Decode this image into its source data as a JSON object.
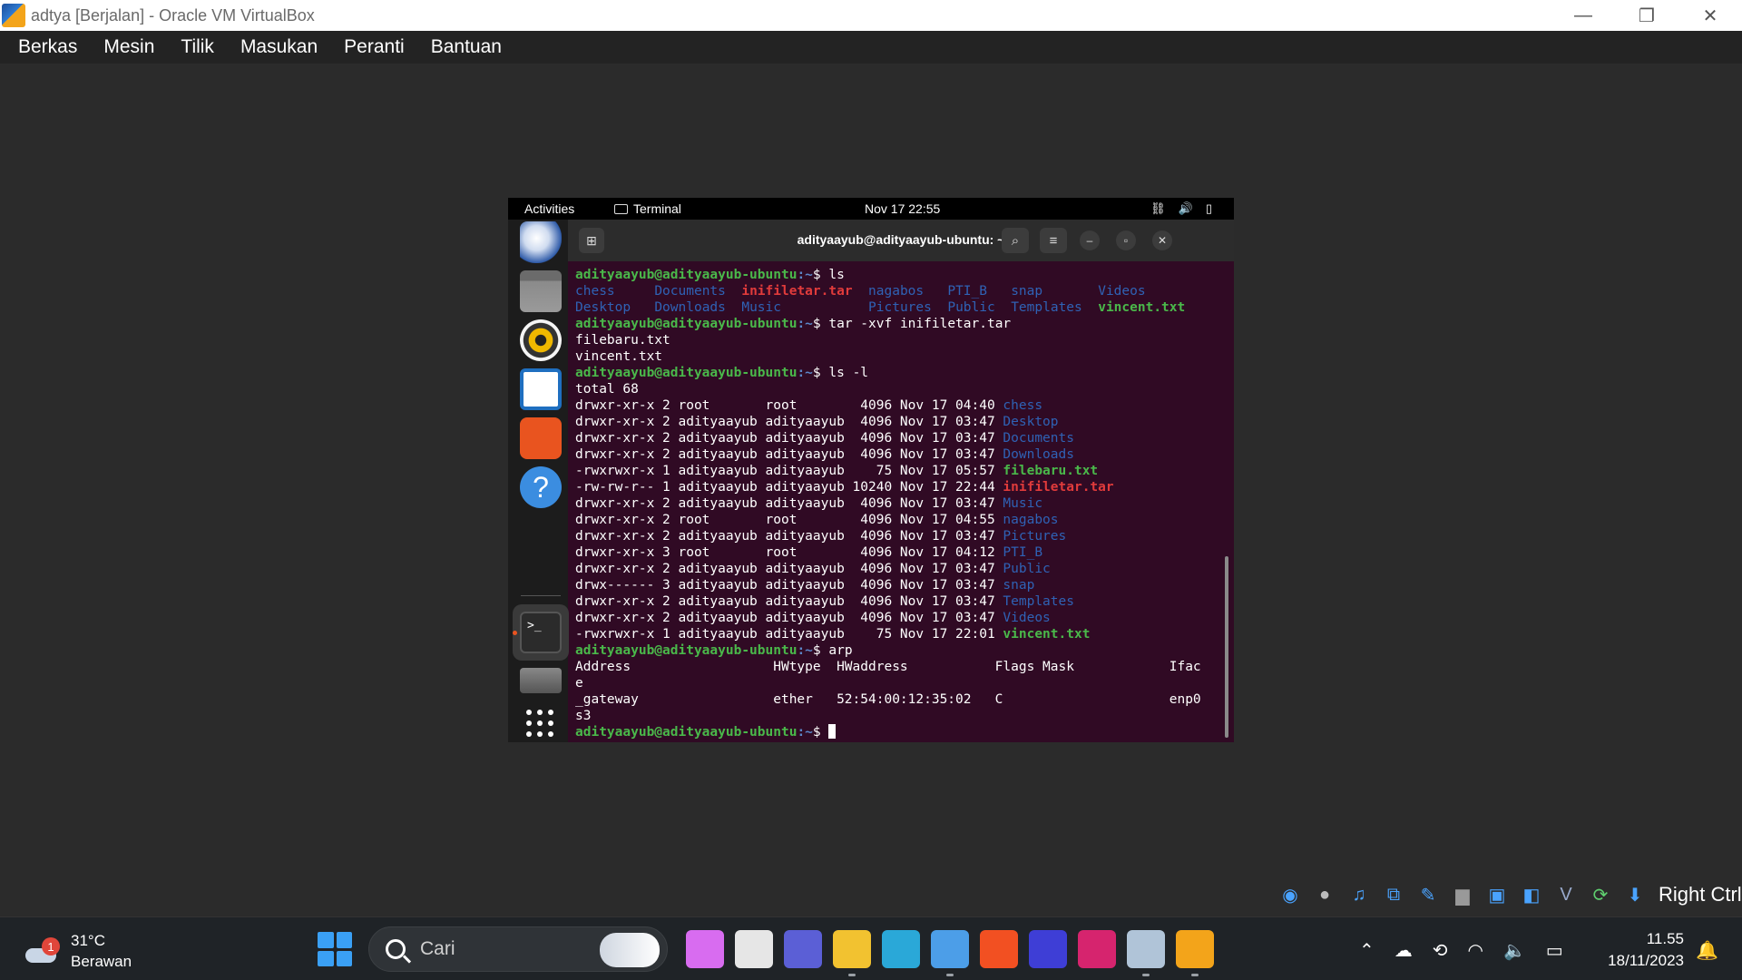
{
  "host_window": {
    "title": "adtya [Berjalan] - Oracle VM VirtualBox",
    "controls": {
      "minimize": "—",
      "maximize": "❐",
      "close": "✕"
    }
  },
  "host_menu": [
    "Berkas",
    "Mesin",
    "Tilik",
    "Masukan",
    "Peranti",
    "Bantuan"
  ],
  "gnome": {
    "activities": "Activities",
    "app_name": "Terminal",
    "clock": "Nov 17  22:55",
    "status_icons": [
      "network-icon",
      "volume-icon",
      "battery-icon"
    ]
  },
  "dock_items": [
    "thunderbird-icon",
    "files-icon",
    "rhythmbox-icon",
    "writer-icon",
    "app-center-icon",
    "help-icon",
    "terminal-icon",
    "removable-drive-icon",
    "show-apps-icon"
  ],
  "terminal": {
    "title": "adityaayub@adityaayub-ubuntu: ~",
    "prompt_user": "adityaayub@adityaayub-ubuntu",
    "prompt_path": ":~",
    "prompt_symbol": "$ ",
    "commands": [
      "ls",
      "tar -xvf inifiletar.tar",
      "ls -l",
      "arp"
    ],
    "ls_row1": [
      {
        "text": "chess     ",
        "cls": "c-dir"
      },
      {
        "text": "Documents  ",
        "cls": "c-dir"
      },
      {
        "text": "inifiletar.tar",
        "cls": "c-red"
      },
      {
        "text": "  ",
        "cls": ""
      },
      {
        "text": "nagabos   ",
        "cls": "c-dir"
      },
      {
        "text": "PTI_B   ",
        "cls": "c-dir"
      },
      {
        "text": "snap       ",
        "cls": "c-dir"
      },
      {
        "text": "Videos",
        "cls": "c-dir"
      }
    ],
    "ls_row2": [
      {
        "text": "Desktop   ",
        "cls": "c-dir"
      },
      {
        "text": "Downloads  ",
        "cls": "c-dir"
      },
      {
        "text": "Music         ",
        "cls": "c-dir"
      },
      {
        "text": "  ",
        "cls": ""
      },
      {
        "text": "Pictures  ",
        "cls": "c-dir"
      },
      {
        "text": "Public  ",
        "cls": "c-dir"
      },
      {
        "text": "Templates  ",
        "cls": "c-dir"
      },
      {
        "text": "vincent.txt",
        "cls": "c-exec"
      }
    ],
    "tar_output": [
      "filebaru.txt",
      "vincent.txt"
    ],
    "total": "total 68",
    "ls_long": [
      {
        "meta": "drwxr-xr-x 2 root       root        4096 Nov 17 04:40 ",
        "name": "chess",
        "cls": "c-dir"
      },
      {
        "meta": "drwxr-xr-x 2 adityaayub adityaayub  4096 Nov 17 03:47 ",
        "name": "Desktop",
        "cls": "c-dir"
      },
      {
        "meta": "drwxr-xr-x 2 adityaayub adityaayub  4096 Nov 17 03:47 ",
        "name": "Documents",
        "cls": "c-dir"
      },
      {
        "meta": "drwxr-xr-x 2 adityaayub adityaayub  4096 Nov 17 03:47 ",
        "name": "Downloads",
        "cls": "c-dir"
      },
      {
        "meta": "-rwxrwxr-x 1 adityaayub adityaayub    75 Nov 17 05:57 ",
        "name": "filebaru.txt",
        "cls": "c-exec"
      },
      {
        "meta": "-rw-rw-r-- 1 adityaayub adityaayub 10240 Nov 17 22:44 ",
        "name": "inifiletar.tar",
        "cls": "c-red"
      },
      {
        "meta": "drwxr-xr-x 2 adityaayub adityaayub  4096 Nov 17 03:47 ",
        "name": "Music",
        "cls": "c-dir"
      },
      {
        "meta": "drwxr-xr-x 2 root       root        4096 Nov 17 04:55 ",
        "name": "nagabos",
        "cls": "c-dir"
      },
      {
        "meta": "drwxr-xr-x 2 adityaayub adityaayub  4096 Nov 17 03:47 ",
        "name": "Pictures",
        "cls": "c-dir"
      },
      {
        "meta": "drwxr-xr-x 3 root       root        4096 Nov 17 04:12 ",
        "name": "PTI_B",
        "cls": "c-dir"
      },
      {
        "meta": "drwxr-xr-x 2 adityaayub adityaayub  4096 Nov 17 03:47 ",
        "name": "Public",
        "cls": "c-dir"
      },
      {
        "meta": "drwx------ 3 adityaayub adityaayub  4096 Nov 17 03:47 ",
        "name": "snap",
        "cls": "c-dir"
      },
      {
        "meta": "drwxr-xr-x 2 adityaayub adityaayub  4096 Nov 17 03:47 ",
        "name": "Templates",
        "cls": "c-dir"
      },
      {
        "meta": "drwxr-xr-x 2 adityaayub adityaayub  4096 Nov 17 03:47 ",
        "name": "Videos",
        "cls": "c-dir"
      },
      {
        "meta": "-rwxrwxr-x 1 adityaayub adityaayub    75 Nov 17 22:01 ",
        "name": "vincent.txt",
        "cls": "c-exec"
      }
    ],
    "arp_lines": [
      "Address                  HWtype  HWaddress           Flags Mask            Ifac",
      "e",
      "_gateway                 ether   52:54:00:12:35:02   C                     enp0",
      "s3"
    ]
  },
  "vbox_status": {
    "icons": [
      "hard-disk-icon",
      "optical-drive-icon",
      "audio-icon",
      "network-adapter-icon",
      "usb-icon",
      "shared-folder-icon",
      "display-icon",
      "recording-icon",
      "vt-x-icon",
      "mouse-integration-icon",
      "download-icon"
    ],
    "host_key": "Right Ctrl"
  },
  "taskbar": {
    "weather_badge": "1",
    "temperature": "31°C",
    "condition": "Berawan",
    "search_placeholder": "Cari",
    "apps": [
      {
        "name": "copilot-pre-icon",
        "color": "#d86cf0"
      },
      {
        "name": "task-view-icon",
        "color": "#e6e6e6"
      },
      {
        "name": "meet-icon",
        "color": "#5b5fd6"
      },
      {
        "name": "file-explorer-icon",
        "color": "#f2c230"
      },
      {
        "name": "edge-icon",
        "color": "#2aa8d8"
      },
      {
        "name": "photos-icon",
        "color": "#4c9ee8"
      },
      {
        "name": "store-icon",
        "color": "#f25022"
      },
      {
        "name": "app-m-icon",
        "color": "#3e3ed6"
      },
      {
        "name": "instagram-icon",
        "color": "#d6246e"
      },
      {
        "name": "virtualbox-cube-icon",
        "color": "#b0c4d8"
      },
      {
        "name": "virtualbox-icon",
        "color": "#f3a41a"
      }
    ],
    "time": "11.55",
    "date": "18/11/2023"
  }
}
